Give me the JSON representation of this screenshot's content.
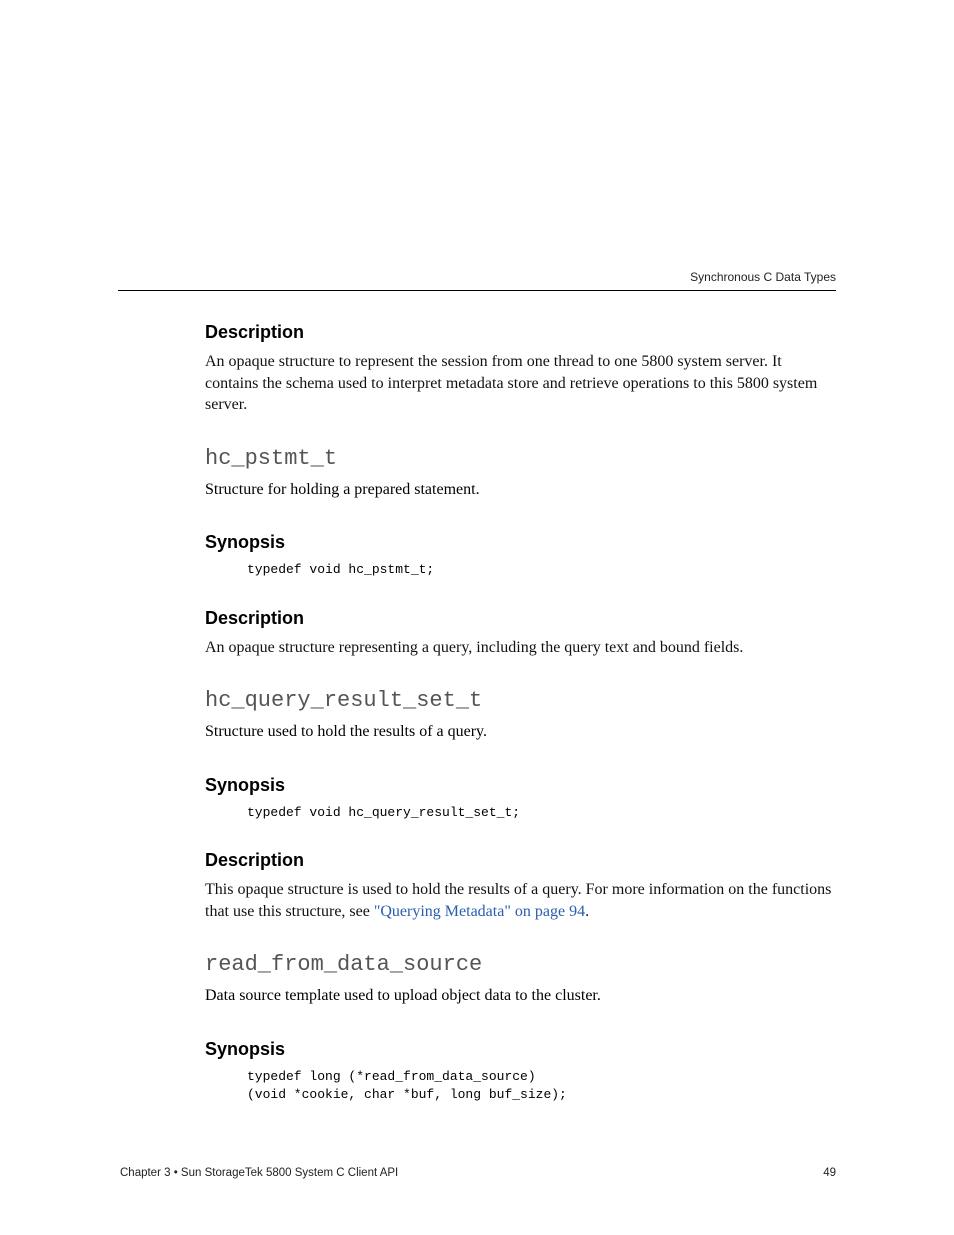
{
  "header": {
    "label": "Synchronous C Data Types"
  },
  "sections": [
    {
      "description_heading": "Description",
      "description_body": "An opaque structure to represent the session from one thread to one 5800 system server. It contains the schema used to interpret metadata store and retrieve operations to this 5800 system server."
    },
    {
      "title": "hc_pstmt_t",
      "intro": "Structure for holding a prepared statement.",
      "synopsis_heading": "Synopsis",
      "synopsis_code": "typedef void hc_pstmt_t;",
      "description_heading": "Description",
      "description_body": "An opaque structure representing a query, including the query text and bound fields."
    },
    {
      "title": "hc_query_result_set_t",
      "intro": "Structure used to hold the results of a query.",
      "synopsis_heading": "Synopsis",
      "synopsis_code": "typedef void hc_query_result_set_t;",
      "description_heading": "Description",
      "description_body_prefix": "This opaque structure is used to hold the results of a query. For more information on the functions that use this structure, see ",
      "description_link": "\"Querying Metadata\" on page 94",
      "description_body_suffix": "."
    },
    {
      "title": "read_from_data_source",
      "intro": "Data source template used to upload object data to the cluster.",
      "synopsis_heading": "Synopsis",
      "synopsis_code": "typedef long (*read_from_data_source)\n(void *cookie, char *buf, long buf_size);"
    }
  ],
  "footer": {
    "left": "Chapter 3 • Sun StorageTek 5800 System C Client API",
    "right": "49"
  }
}
